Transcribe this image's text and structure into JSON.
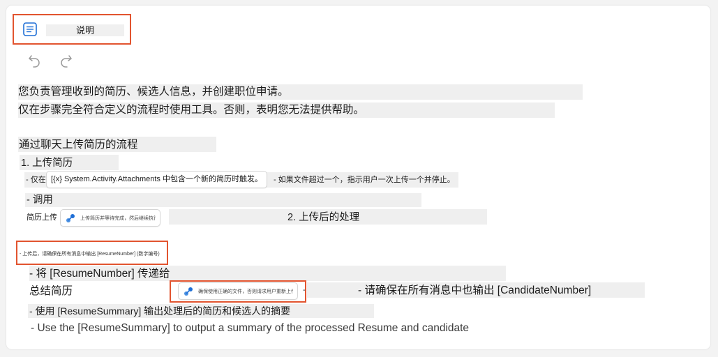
{
  "header": {
    "title": "说明"
  },
  "toolbar": {
    "undo_icon": "undo-icon",
    "redo_icon": "redo-icon"
  },
  "content": {
    "intro_line1": "您负责管理收到的简历、候选人信息，并创建职位申请。",
    "intro_line2": "仅在步骤完全符合定义的流程时使用工具。否则，表明您无法提供帮助。",
    "section_title": "通过聊天上传简历的流程",
    "step1": "1. 上传简历",
    "step1_condition_prefix": "- 仅在",
    "step1_condition_chip": "[{x} System.Activity.Attachments 中包含一个新的简历时触发。",
    "step1_condition_suffix": "- 如果文件超过一个，指示用户一次上传一个并停止。",
    "invoke": "- 调用",
    "upload_label": "简历上传",
    "upload_chip": "上传简历并等待完成，然后继续执行下一步",
    "step2": "2. 上传后的处理",
    "output_note": "- 上传后，请确保在所有消息中输出 [ResumeNumber] (数字编号)",
    "pass_resume_number": "- 将 [ResumeNumber] 传递给",
    "summarize_label": "总结简历",
    "summarize_chip": "确保使用正确的文件，否则请求用户重新上传。",
    "candidate_number_note": "- 请确保在所有消息中也输出 [CandidateNumber]",
    "use_summary_cn": "- 使用 [ResumeSummary] 输出处理后的简历和候选人的摘要",
    "use_summary_en": "- Use the [ResumeSummary] to output a summary of the processed Resume and candidate"
  },
  "colors": {
    "highlight_border": "#e2542f",
    "accent": "#1f6fd6",
    "background": "#f3f3f3"
  }
}
